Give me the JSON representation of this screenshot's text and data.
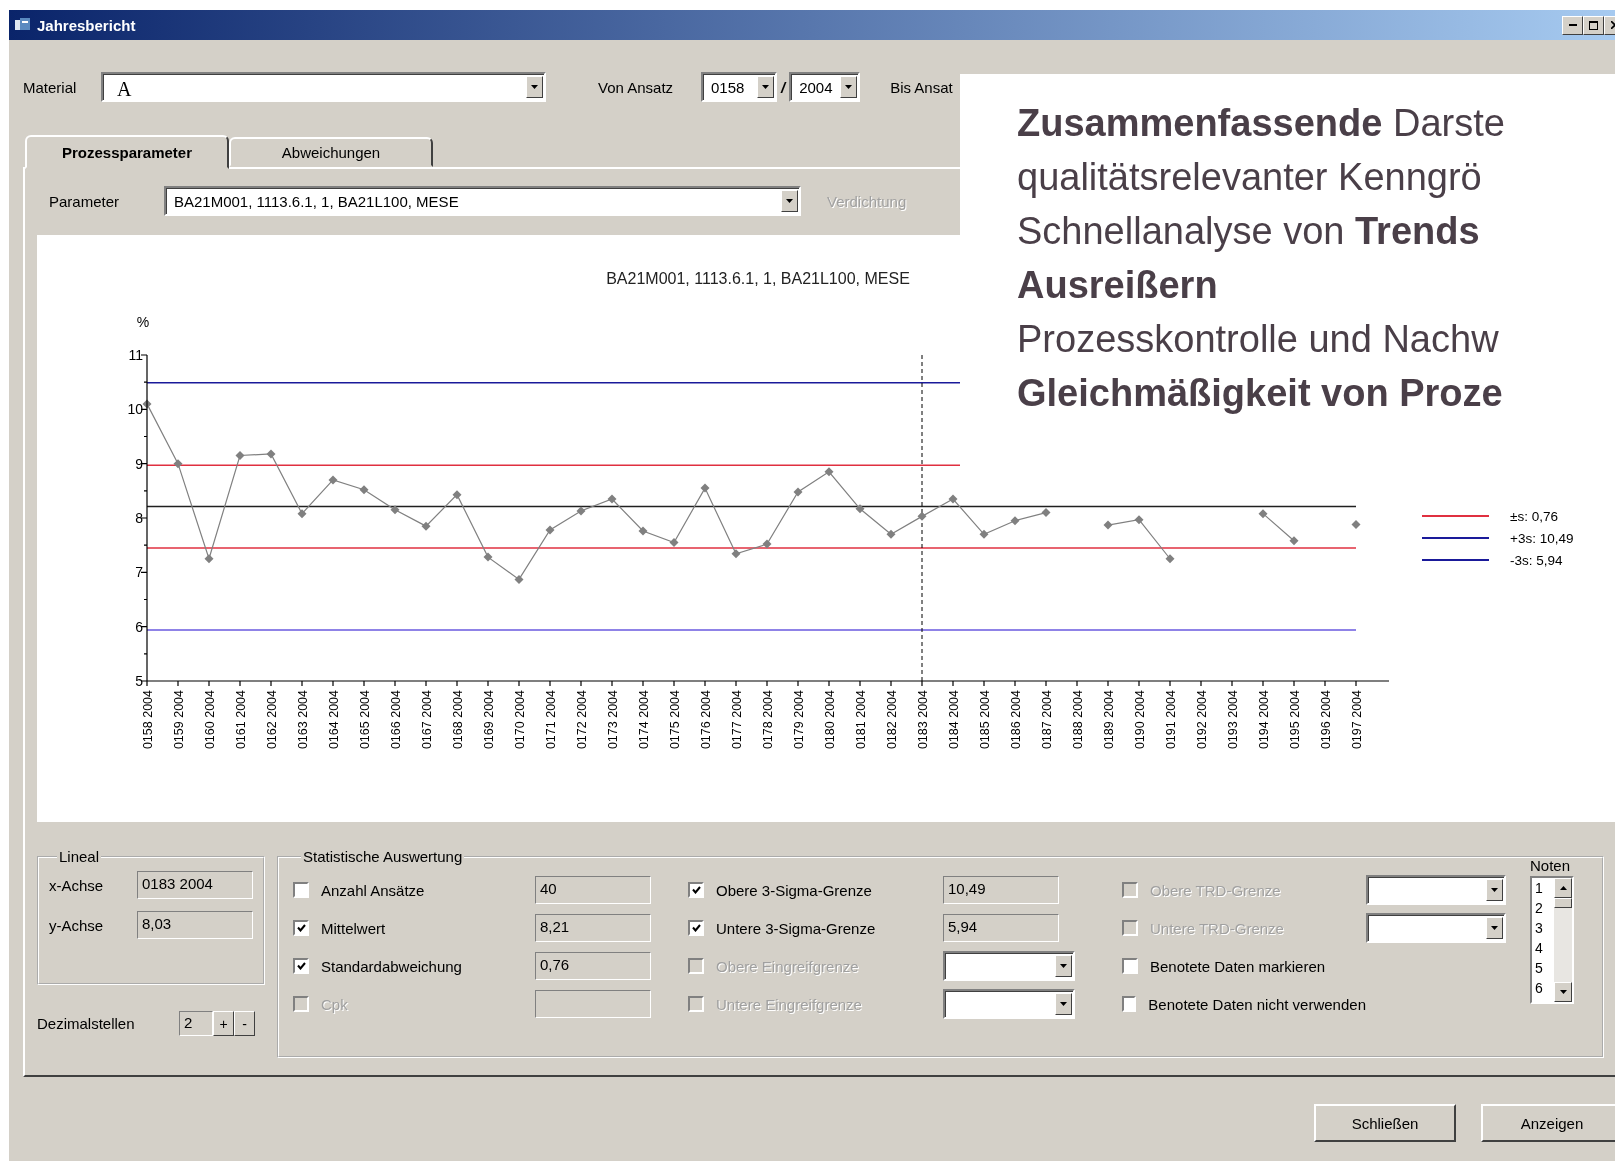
{
  "window": {
    "title": "Jahresbericht"
  },
  "material": {
    "label": "Material",
    "value": "A"
  },
  "von_ansatz": {
    "label": "Von Ansatz",
    "number": "0158",
    "separator": "/",
    "year": "2004"
  },
  "bis_ansatz": {
    "label": "Bis Ansat"
  },
  "tabs": [
    {
      "label": "Prozessparameter",
      "selected": true
    },
    {
      "label": "Abweichungen",
      "selected": false
    }
  ],
  "parameter": {
    "label": "Parameter",
    "value": "BA21M001, 1113.6.1, 1, BA21L100, MESE"
  },
  "verdichtung": {
    "label": "Verdichtung",
    "disabled": true
  },
  "chart": {
    "chart_data": {
      "type": "line",
      "title": "BA21M001, 1113.6.1, 1, BA21L100, MESE",
      "ylabel": "%",
      "categories": [
        "0158 2004",
        "0159 2004",
        "0160 2004",
        "0161 2004",
        "0162 2004",
        "0163 2004",
        "0164 2004",
        "0165 2004",
        "0166 2004",
        "0167 2004",
        "0168 2004",
        "0169 2004",
        "0170 2004",
        "0171 2004",
        "0172 2004",
        "0173 2004",
        "0174 2004",
        "0175 2004",
        "0176 2004",
        "0177 2004",
        "0178 2004",
        "0179 2004",
        "0180 2004",
        "0181 2004",
        "0182 2004",
        "0183 2004",
        "0184 2004",
        "0185 2004",
        "0186 2004",
        "0187 2004",
        "0188 2004",
        "0189 2004",
        "0190 2004",
        "0191 2004",
        "0192 2004",
        "0193 2004",
        "0194 2004",
        "0195 2004",
        "0196 2004",
        "0197 2004"
      ],
      "series": [
        {
          "color": "#808080",
          "marker": "diamond",
          "values": [
            10.1,
            9.0,
            7.25,
            9.15,
            9.18,
            8.08,
            8.7,
            8.52,
            8.15,
            7.85,
            8.43,
            7.28,
            6.87,
            7.78,
            8.13,
            8.35,
            7.76,
            7.55,
            8.55,
            7.34,
            7.52,
            8.48,
            8.85,
            8.17,
            7.7,
            8.03,
            8.35,
            7.7,
            7.95,
            8.1,
            null,
            7.87,
            7.97,
            7.25,
            null,
            null,
            8.08,
            7.58,
            null,
            7.88
          ]
        }
      ],
      "ylim": [
        5,
        11
      ],
      "yticks": [
        5,
        6,
        7,
        8,
        9,
        10,
        11
      ],
      "ref_lines": [
        {
          "axis": "y",
          "value": 10.49,
          "color": "#1a1a9a"
        },
        {
          "axis": "y",
          "value": 8.97,
          "color": "#e03040"
        },
        {
          "axis": "y",
          "value": 8.21,
          "color": "#202020"
        },
        {
          "axis": "y",
          "value": 7.45,
          "color": "#e03040"
        },
        {
          "axis": "y",
          "value": 5.94,
          "color": "#6a5adf"
        },
        {
          "axis": "x",
          "value": "0183 2004",
          "color": "#000000"
        }
      ]
    },
    "legend": [
      {
        "label": "±s: 0,76",
        "color": "#e03040"
      },
      {
        "label": "+3s: 10,49",
        "color": "#1a1a9a"
      },
      {
        "label": "-3s: 5,94",
        "color": "#1a1a9a"
      }
    ]
  },
  "lineal": {
    "title": "Lineal",
    "fields": [
      {
        "label": "x-Achse",
        "value": "0183 2004"
      },
      {
        "label": "y-Achse",
        "value": "8,03"
      }
    ]
  },
  "dezimalstellen": {
    "label": "Dezimalstellen",
    "value": "2",
    "buttons": [
      "+",
      "-"
    ]
  },
  "statistik": {
    "title": "Statistische Auswertung",
    "rows": [
      [
        {
          "label": "Anzahl Ansätze",
          "checked": false,
          "disabled": false,
          "kind": "field",
          "value": "40"
        },
        {
          "label": "Obere 3-Sigma-Grenze",
          "checked": true,
          "disabled": false,
          "kind": "field",
          "value": "10,49"
        },
        {
          "label": "Obere TRD-Grenze",
          "checked": false,
          "disabled": true,
          "kind": "combo"
        }
      ],
      [
        {
          "label": "Mittelwert",
          "checked": true,
          "disabled": false,
          "kind": "field",
          "value": "8,21"
        },
        {
          "label": "Untere 3-Sigma-Grenze",
          "checked": true,
          "disabled": false,
          "kind": "field",
          "value": "5,94"
        },
        {
          "label": "Untere TRD-Grenze",
          "checked": false,
          "disabled": true,
          "kind": "combo"
        }
      ],
      [
        {
          "label": "Standardabweichung",
          "checked": true,
          "disabled": false,
          "kind": "field",
          "value": "0,76"
        },
        {
          "label": "Obere Eingreifgrenze",
          "checked": false,
          "disabled": true,
          "kind": "combo"
        },
        {
          "label": "Benotete Daten markieren",
          "checked": false,
          "disabled": false,
          "kind": "plain"
        }
      ],
      [
        {
          "label": "Cpk",
          "checked": false,
          "disabled": true,
          "kind": "field"
        },
        {
          "label": "Untere Eingreifgrenze",
          "checked": false,
          "disabled": true,
          "kind": "combo"
        },
        {
          "label": "Benotete Daten nicht verwenden",
          "checked": false,
          "disabled": false,
          "kind": "plain"
        }
      ]
    ]
  },
  "noten": {
    "label": "Noten",
    "items": [
      "1",
      "2",
      "3",
      "4",
      "5",
      "6"
    ]
  },
  "buttons": [
    "Schließen",
    "Anzeigen"
  ],
  "overlay": {
    "lines": [
      "**Zusammenfassende** Darste",
      "qualitätsrelevanter Kenngrö",
      "Schnellanalyse von **Trends**",
      "**Ausreißern**",
      "Prozesskontrolle und Nachw",
      "**Gleichmäßigkeit von Proze**"
    ]
  }
}
